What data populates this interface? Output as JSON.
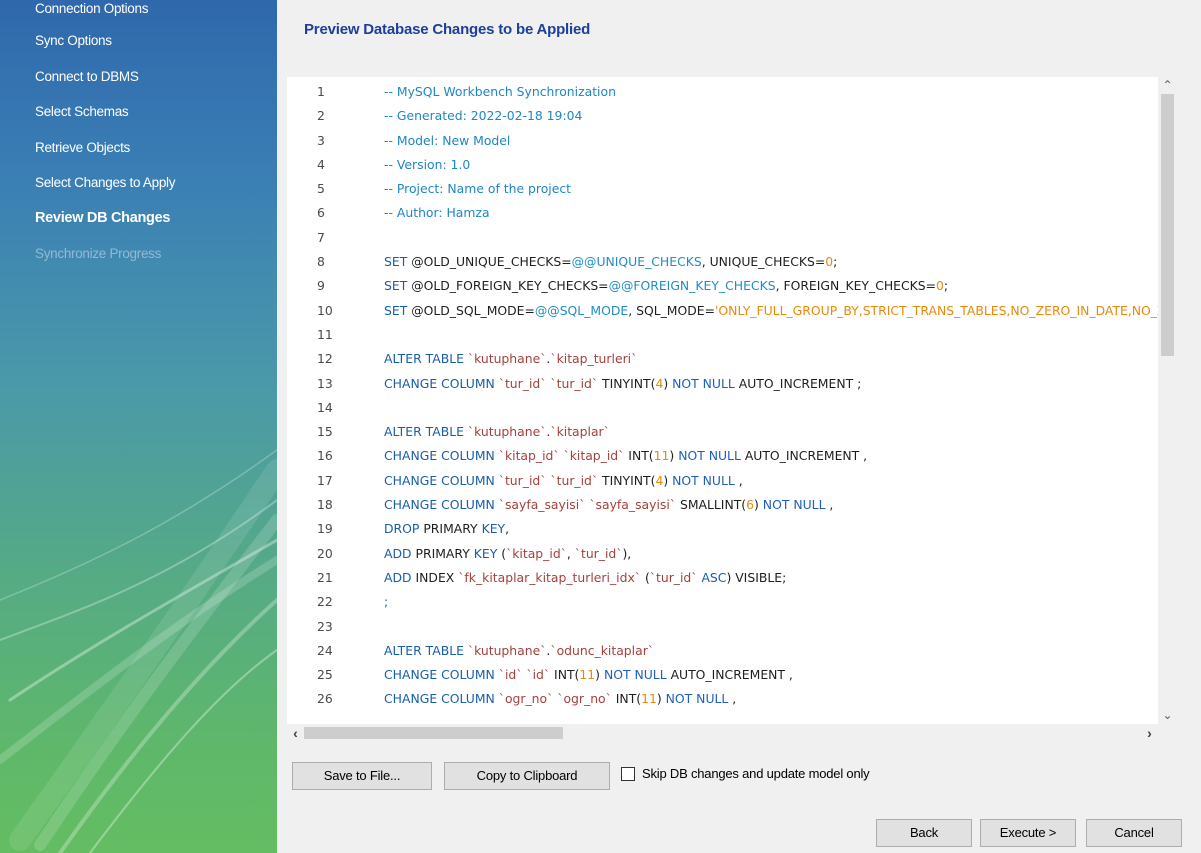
{
  "sidebar": {
    "steps": [
      {
        "label": "Connection Options",
        "state": "done"
      },
      {
        "label": "Sync Options",
        "state": "done"
      },
      {
        "label": "Connect to DBMS",
        "state": "done"
      },
      {
        "label": "Select Schemas",
        "state": "done"
      },
      {
        "label": "Retrieve Objects",
        "state": "done"
      },
      {
        "label": "Select Changes to Apply",
        "state": "done"
      },
      {
        "label": "Review DB Changes",
        "state": "current"
      },
      {
        "label": "Synchronize Progress",
        "state": "pending"
      }
    ]
  },
  "main": {
    "heading": "Preview Database Changes to be Applied",
    "editor": {
      "lines": [
        {
          "n": "1",
          "tokens": [
            {
              "t": "-- MySQL Workbench Synchronization",
              "c": "cmt"
            }
          ]
        },
        {
          "n": "2",
          "tokens": [
            {
              "t": "-- Generated: 2022-02-18 19:04",
              "c": "cmt"
            }
          ]
        },
        {
          "n": "3",
          "tokens": [
            {
              "t": "-- Model: New Model",
              "c": "cmt"
            }
          ]
        },
        {
          "n": "4",
          "tokens": [
            {
              "t": "-- Version: 1.0",
              "c": "cmt"
            }
          ]
        },
        {
          "n": "5",
          "tokens": [
            {
              "t": "-- Project: Name of the project",
              "c": "cmt"
            }
          ]
        },
        {
          "n": "6",
          "tokens": [
            {
              "t": "-- Author: Hamza",
              "c": "cmt"
            }
          ]
        },
        {
          "n": "7",
          "tokens": []
        },
        {
          "n": "8",
          "tokens": [
            {
              "t": "SET ",
              "c": "kw"
            },
            {
              "t": "@OLD_UNIQUE_CHECKS="
            },
            {
              "t": "@@UNIQUE_CHECKS",
              "c": "var"
            },
            {
              "t": ", UNIQUE_CHECKS="
            },
            {
              "t": "0",
              "c": "num"
            },
            {
              "t": ";"
            }
          ]
        },
        {
          "n": "9",
          "tokens": [
            {
              "t": "SET ",
              "c": "kw"
            },
            {
              "t": "@OLD_FOREIGN_KEY_CHECKS="
            },
            {
              "t": "@@FOREIGN_KEY_CHECKS",
              "c": "var"
            },
            {
              "t": ", FOREIGN_KEY_CHECKS="
            },
            {
              "t": "0",
              "c": "num"
            },
            {
              "t": ";"
            }
          ]
        },
        {
          "n": "10",
          "tokens": [
            {
              "t": "SET ",
              "c": "kw"
            },
            {
              "t": "@OLD_SQL_MODE="
            },
            {
              "t": "@@SQL_MODE",
              "c": "var"
            },
            {
              "t": ", SQL_MODE="
            },
            {
              "t": "'ONLY_FULL_GROUP_BY,STRICT_TRANS_TABLES,NO_ZERO_IN_DATE,NO_ZERO_DATE,ERROR_FOR_DIVISION_BY_ZERO,NO_ENGINE_SUBSTITUTION';",
              "c": "str"
            }
          ]
        },
        {
          "n": "11",
          "tokens": []
        },
        {
          "n": "12",
          "tokens": [
            {
              "t": "ALTER TABLE ",
              "c": "kw"
            },
            {
              "t": "`kutuphane`",
              "c": "ident"
            },
            {
              "t": "."
            },
            {
              "t": "`kitap_turleri`",
              "c": "ident"
            }
          ]
        },
        {
          "n": "13",
          "tokens": [
            {
              "t": "CHANGE COLUMN ",
              "c": "kw"
            },
            {
              "t": "`tur_id`",
              "c": "ident"
            },
            {
              "t": " "
            },
            {
              "t": "`tur_id`",
              "c": "ident"
            },
            {
              "t": " TINYINT("
            },
            {
              "t": "4",
              "c": "num"
            },
            {
              "t": ") "
            },
            {
              "t": "NOT NULL",
              "c": "nn"
            },
            {
              "t": " AUTO_INCREMENT ;"
            }
          ]
        },
        {
          "n": "14",
          "tokens": []
        },
        {
          "n": "15",
          "tokens": [
            {
              "t": "ALTER TABLE ",
              "c": "kw"
            },
            {
              "t": "`kutuphane`",
              "c": "ident"
            },
            {
              "t": "."
            },
            {
              "t": "`kitaplar`",
              "c": "ident"
            }
          ]
        },
        {
          "n": "16",
          "tokens": [
            {
              "t": "CHANGE COLUMN ",
              "c": "kw"
            },
            {
              "t": "`kitap_id`",
              "c": "ident"
            },
            {
              "t": " "
            },
            {
              "t": "`kitap_id`",
              "c": "ident"
            },
            {
              "t": " INT("
            },
            {
              "t": "11",
              "c": "num"
            },
            {
              "t": ") "
            },
            {
              "t": "NOT NULL",
              "c": "nn"
            },
            {
              "t": " AUTO_INCREMENT ,"
            }
          ]
        },
        {
          "n": "17",
          "tokens": [
            {
              "t": "CHANGE COLUMN ",
              "c": "kw"
            },
            {
              "t": "`tur_id`",
              "c": "ident"
            },
            {
              "t": " "
            },
            {
              "t": "`tur_id`",
              "c": "ident"
            },
            {
              "t": " TINYINT("
            },
            {
              "t": "4",
              "c": "num"
            },
            {
              "t": ") "
            },
            {
              "t": "NOT NULL",
              "c": "nn"
            },
            {
              "t": " ,"
            }
          ]
        },
        {
          "n": "18",
          "tokens": [
            {
              "t": "CHANGE COLUMN ",
              "c": "kw"
            },
            {
              "t": "`sayfa_sayisi`",
              "c": "ident"
            },
            {
              "t": " "
            },
            {
              "t": "`sayfa_sayisi`",
              "c": "ident"
            },
            {
              "t": " SMALLINT("
            },
            {
              "t": "6",
              "c": "num"
            },
            {
              "t": ") "
            },
            {
              "t": "NOT NULL",
              "c": "nn"
            },
            {
              "t": " ,"
            }
          ]
        },
        {
          "n": "19",
          "tokens": [
            {
              "t": "DROP ",
              "c": "kw"
            },
            {
              "t": "PRIMARY "
            },
            {
              "t": "KEY",
              "c": "kw"
            },
            {
              "t": ","
            }
          ]
        },
        {
          "n": "20",
          "tokens": [
            {
              "t": "ADD ",
              "c": "kw"
            },
            {
              "t": "PRIMARY "
            },
            {
              "t": "KEY",
              "c": "kw"
            },
            {
              "t": " ("
            },
            {
              "t": "`kitap_id`",
              "c": "ident"
            },
            {
              "t": ", "
            },
            {
              "t": "`tur_id`",
              "c": "ident"
            },
            {
              "t": "),"
            }
          ]
        },
        {
          "n": "21",
          "tokens": [
            {
              "t": "ADD ",
              "c": "kw"
            },
            {
              "t": "INDEX "
            },
            {
              "t": "`fk_kitaplar_kitap_turleri_idx`",
              "c": "ident"
            },
            {
              "t": " ("
            },
            {
              "t": "`tur_id`",
              "c": "ident"
            },
            {
              "t": " "
            },
            {
              "t": "ASC",
              "c": "kw"
            },
            {
              "t": ") VISIBLE;"
            }
          ]
        },
        {
          "n": "22",
          "tokens": [
            {
              "t": ";",
              "c": "nn"
            }
          ]
        },
        {
          "n": "23",
          "tokens": []
        },
        {
          "n": "24",
          "tokens": [
            {
              "t": "ALTER TABLE ",
              "c": "kw"
            },
            {
              "t": "`kutuphane`",
              "c": "ident"
            },
            {
              "t": "."
            },
            {
              "t": "`odunc_kitaplar`",
              "c": "ident"
            }
          ]
        },
        {
          "n": "25",
          "tokens": [
            {
              "t": "CHANGE COLUMN ",
              "c": "kw"
            },
            {
              "t": "`id`",
              "c": "ident"
            },
            {
              "t": " "
            },
            {
              "t": "`id`",
              "c": "ident"
            },
            {
              "t": " INT("
            },
            {
              "t": "11",
              "c": "num"
            },
            {
              "t": ") "
            },
            {
              "t": "NOT NULL",
              "c": "nn"
            },
            {
              "t": " AUTO_INCREMENT ,"
            }
          ]
        },
        {
          "n": "26",
          "tokens": [
            {
              "t": "CHANGE COLUMN ",
              "c": "kw"
            },
            {
              "t": "`ogr_no`",
              "c": "ident"
            },
            {
              "t": " "
            },
            {
              "t": "`ogr_no`",
              "c": "ident"
            },
            {
              "t": " INT("
            },
            {
              "t": "11",
              "c": "num"
            },
            {
              "t": ") "
            },
            {
              "t": "NOT NULL",
              "c": "nn"
            },
            {
              "t": " ,"
            }
          ]
        }
      ],
      "scrollbar_icons": {
        "up": "chevron-up-icon",
        "down": "chevron-down-icon",
        "left": "chevron-left-icon",
        "right": "chevron-right-icon"
      }
    },
    "save_button": "Save to File...",
    "copy_button": "Copy to Clipboard",
    "skip_checkbox": {
      "label": "Skip DB changes and update model only",
      "checked": false
    }
  },
  "footer": {
    "back": "Back",
    "execute": "Execute >",
    "cancel": "Cancel"
  },
  "colors": {
    "heading": "#1d3f99",
    "sidebar_top": "#2f68ac",
    "sidebar_bottom": "#64bd62",
    "comment": "#1f86c4",
    "keyword": "#185ea8",
    "string": "#e8890c",
    "identifier": "#a3413c"
  }
}
